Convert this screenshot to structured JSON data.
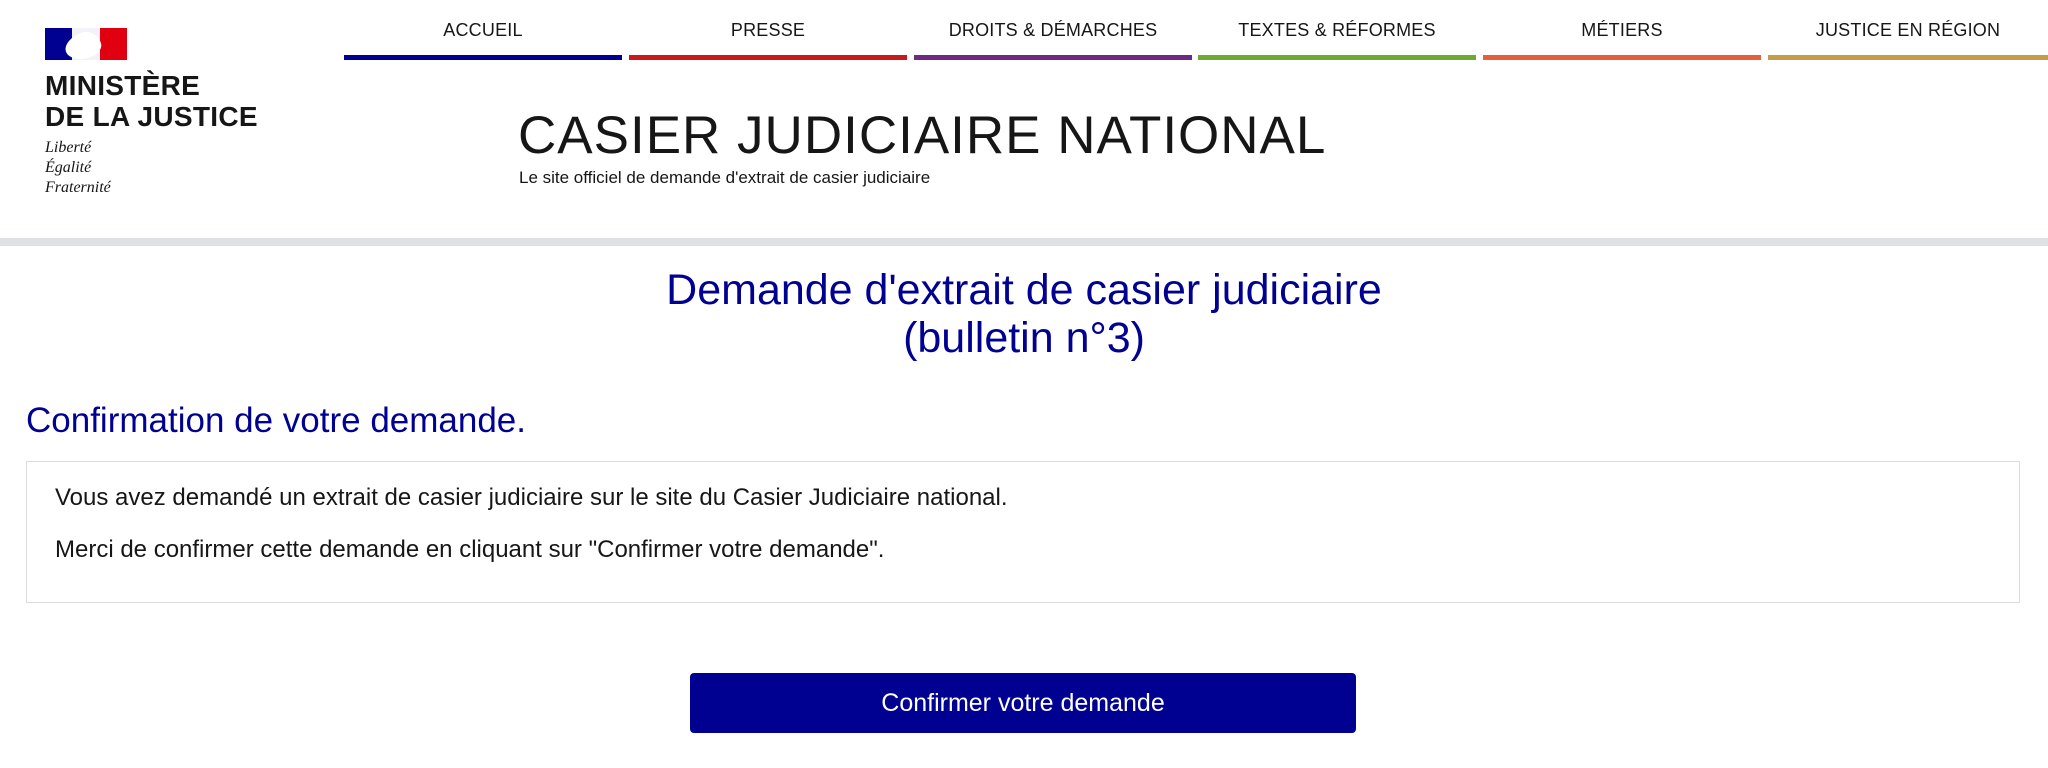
{
  "header": {
    "ministry_line1": "MINISTÈRE",
    "ministry_line2": "DE LA JUSTICE",
    "motto": [
      "Liberté",
      "Égalité",
      "Fraternité"
    ],
    "site_title": "CASIER JUDICIAIRE NATIONAL",
    "site_subtitle": "Le site officiel de demande d'extrait de casier judiciaire"
  },
  "nav": {
    "items": [
      {
        "label": "ACCUEIL",
        "color": "#000091"
      },
      {
        "label": "PRESSE",
        "color": "#c9191e"
      },
      {
        "label": "DROITS & DÉMARCHES",
        "color": "#6e2a82"
      },
      {
        "label": "TEXTES & RÉFORMES",
        "color": "#6eaa2e"
      },
      {
        "label": "MÉTIERS",
        "color": "#e4603a"
      },
      {
        "label": "JUSTICE EN RÉGION",
        "color": "#c69c47"
      }
    ]
  },
  "main": {
    "title_line1": "Demande d'extrait de casier judiciaire",
    "title_line2": "(bulletin n°3)",
    "section_title": "Confirmation de votre demande.",
    "message_line1": "Vous avez demandé un extrait de casier judiciaire sur le site du Casier Judiciaire national.",
    "message_line2": "Merci de confirmer cette demande en cliquant sur \"Confirmer votre demande\".",
    "confirm_button_label": "Confirmer votre demande"
  },
  "colors": {
    "primary_blue": "#000091",
    "flag_red": "#e1000f",
    "header_rule": "#dfe2e5"
  }
}
